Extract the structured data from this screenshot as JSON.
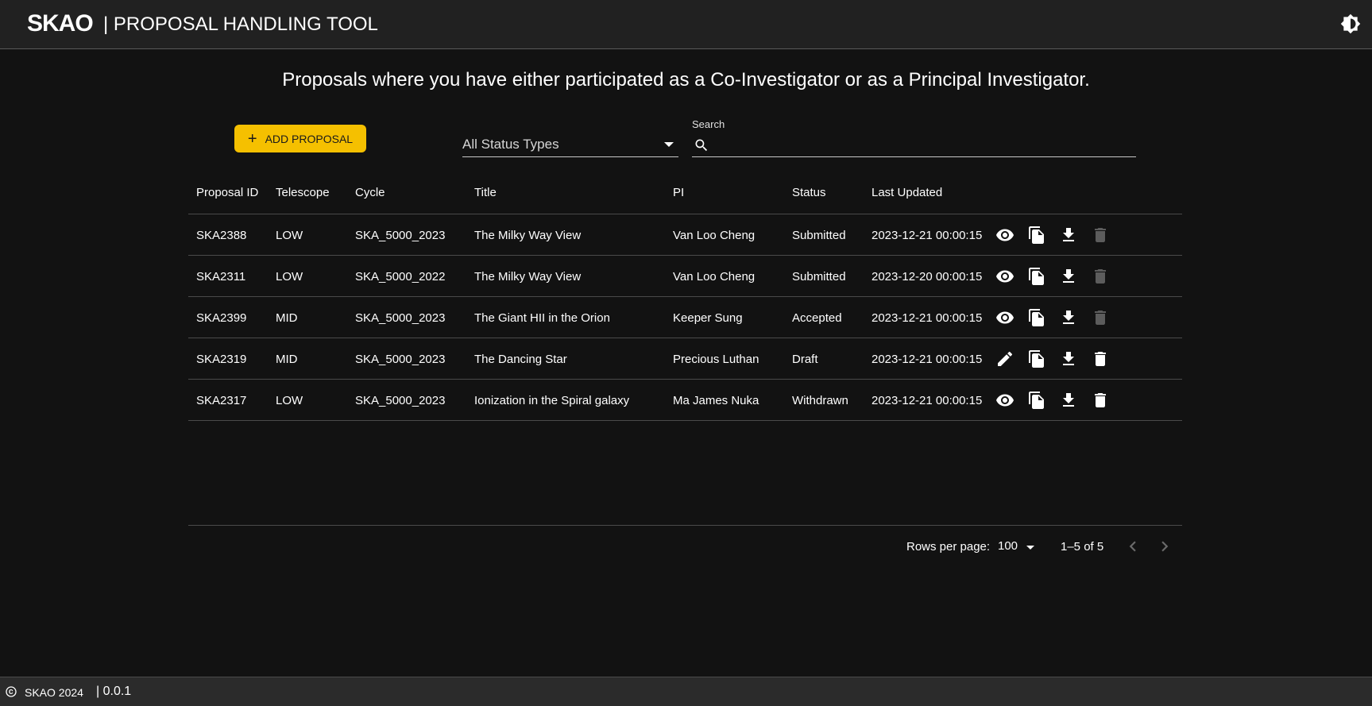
{
  "header": {
    "logo": "SKAO",
    "title": "| PROPOSAL HANDLING TOOL",
    "theme_icon": "brightness-icon"
  },
  "page": {
    "heading": "Proposals where you have either participated as a Co-Investigator or as a Principal Investigator."
  },
  "toolbar": {
    "add_label": "ADD PROPOSAL",
    "add_icon": "plus-icon",
    "status_filter": "All Status Types",
    "search_label": "Search",
    "search_value": ""
  },
  "table": {
    "columns": [
      "Proposal ID",
      "Telescope",
      "Cycle",
      "Title",
      "PI",
      "Status",
      "Last Updated"
    ],
    "rows": [
      {
        "id": "SKA2388",
        "telescope": "LOW",
        "cycle": "SKA_5000_2023",
        "title": "The Milky Way View",
        "pi": "Van Loo Cheng",
        "status": "Submitted",
        "updated": "2023-12-21 00:00:15",
        "primary_action": "view",
        "delete_enabled": false
      },
      {
        "id": "SKA2311",
        "telescope": "LOW",
        "cycle": "SKA_5000_2022",
        "title": "The Milky Way View",
        "pi": "Van Loo Cheng",
        "status": "Submitted",
        "updated": "2023-12-20 00:00:15",
        "primary_action": "view",
        "delete_enabled": false
      },
      {
        "id": "SKA2399",
        "telescope": "MID",
        "cycle": "SKA_5000_2023",
        "title": "The Giant HII in the Orion",
        "pi": "Keeper Sung",
        "status": "Accepted",
        "updated": "2023-12-21 00:00:15",
        "primary_action": "view",
        "delete_enabled": false
      },
      {
        "id": "SKA2319",
        "telescope": "MID",
        "cycle": "SKA_5000_2023",
        "title": "The Dancing Star",
        "pi": "Precious Luthan",
        "status": "Draft",
        "updated": "2023-12-21 00:00:15",
        "primary_action": "edit",
        "delete_enabled": true
      },
      {
        "id": "SKA2317",
        "telescope": "LOW",
        "cycle": "SKA_5000_2023",
        "title": "Ionization in the Spiral galaxy",
        "pi": "Ma James Nuka",
        "status": "Withdrawn",
        "updated": "2023-12-21 00:00:15",
        "primary_action": "view",
        "delete_enabled": true
      }
    ]
  },
  "pagination": {
    "rows_per_page_label": "Rows per page:",
    "rows_per_page": "100",
    "range": "1–5 of 5"
  },
  "footer": {
    "org": "SKAO 2024",
    "version": "| 0.0.1"
  },
  "colors": {
    "accent": "#f5c000",
    "background": "#121212",
    "header": "#212121",
    "disabled_icon": "#5c5c5c"
  }
}
